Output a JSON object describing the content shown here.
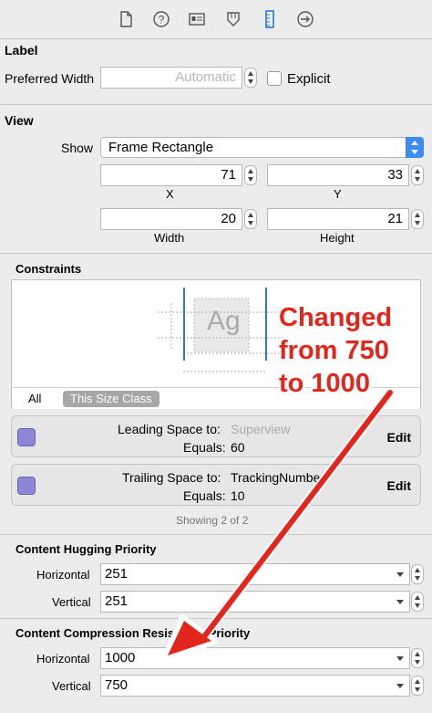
{
  "toolbar": {
    "icons": [
      "file-icon",
      "help-icon",
      "identity-icon",
      "attributes-icon",
      "size-icon",
      "connections-icon"
    ]
  },
  "label_section": {
    "title": "Label",
    "preferred_width_label": "Preferred Width",
    "preferred_width_placeholder": "Automatic",
    "explicit_label": "Explicit"
  },
  "view_section": {
    "title": "View",
    "show_label": "Show",
    "show_value": "Frame Rectangle",
    "x_value": "71",
    "y_value": "33",
    "x_label": "X",
    "y_label": "Y",
    "width_value": "20",
    "height_value": "21",
    "width_label": "Width",
    "height_label": "Height"
  },
  "constraints_section": {
    "title": "Constraints",
    "preview_text": "Ag",
    "filter_all": "All",
    "filter_size_class": "This Size Class",
    "items": [
      {
        "label": "Leading Space to:",
        "target": "Superview",
        "equals_label": "Equals:",
        "equals_value": "60",
        "edit": "Edit"
      },
      {
        "label": "Trailing Space to:",
        "target": "TrackingNumber",
        "equals_label": "Equals:",
        "equals_value": "10",
        "edit": "Edit"
      }
    ],
    "showing": "Showing 2 of 2"
  },
  "hugging_section": {
    "title": "Content Hugging Priority",
    "horizontal_label": "Horizontal",
    "horizontal_value": "251",
    "vertical_label": "Vertical",
    "vertical_value": "251"
  },
  "compression_section": {
    "title": "Content Compression Resistance Priority",
    "horizontal_label": "Horizontal",
    "horizontal_value": "1000",
    "vertical_label": "Vertical",
    "vertical_value": "750"
  },
  "annotation": {
    "line1": "Changed",
    "line2": "from 750",
    "line3": "to 1000",
    "color": "#e3261c"
  },
  "colors": {
    "accent": "#3b8bf4",
    "constraint_icon": "#8c86d6",
    "guide_line": "#2b78d6"
  }
}
